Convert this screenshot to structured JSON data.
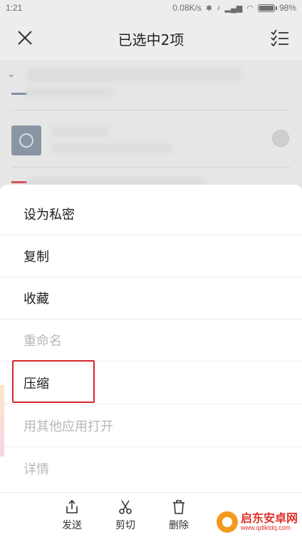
{
  "status_bar": {
    "time": "1:21",
    "network_speed": "0.08K/s",
    "battery": "98%"
  },
  "header": {
    "title": "已选中2项"
  },
  "menu": {
    "items": [
      {
        "label": "设为私密",
        "enabled": true
      },
      {
        "label": "复制",
        "enabled": true
      },
      {
        "label": "收藏",
        "enabled": true
      },
      {
        "label": "重命名",
        "enabled": false
      },
      {
        "label": "压缩",
        "enabled": true,
        "highlighted": true
      },
      {
        "label": "用其他应用打开",
        "enabled": false
      },
      {
        "label": "详情",
        "enabled": false
      }
    ]
  },
  "actions": {
    "send": "发送",
    "cut": "剪切",
    "delete": "删除"
  },
  "watermark": {
    "title": "启东安卓网",
    "url": "www.qdlktdq.com"
  },
  "colors": {
    "highlight_border": "#d8262c",
    "sheet_background": "#ffffff",
    "disabled_text": "#b8b8b8"
  }
}
